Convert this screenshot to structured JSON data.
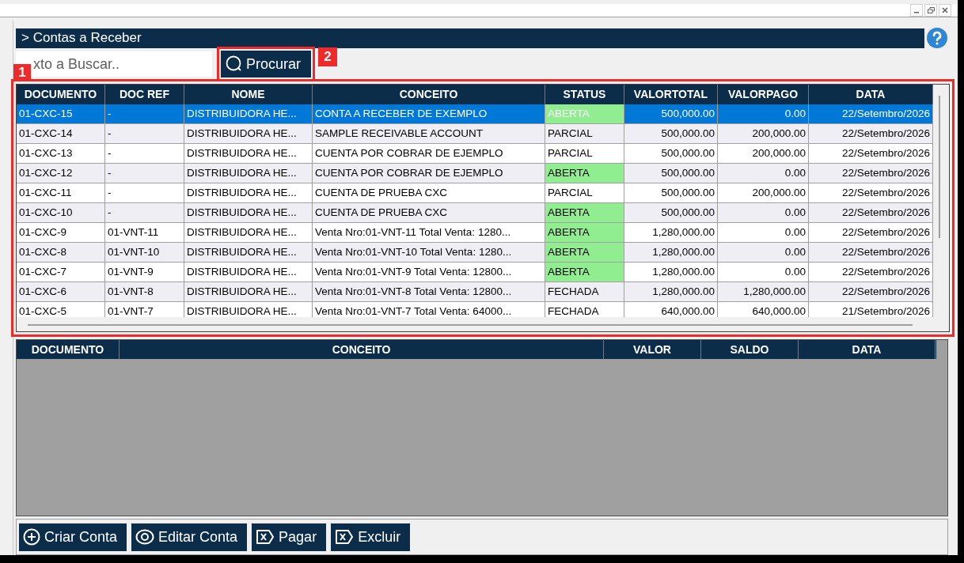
{
  "panel_title": "> Contas a Receber",
  "search": {
    "placeholder": "xto a Buscar..",
    "button": "Procurar"
  },
  "annotations": [
    "1",
    "2"
  ],
  "table": {
    "columns": [
      "DOCUMENTO",
      "DOC REF",
      "NOME",
      "CONCEITO",
      "STATUS",
      "VALORTOTAL",
      "VALORPAGO",
      "DATA"
    ],
    "rows": [
      {
        "selected": true,
        "color": "#90ee90",
        "cells": [
          "01-CXC-15",
          "-",
          "DISTRIBUIDORA HE...",
          "CONTA A RECEBER DE EXEMPLO",
          "ABERTA",
          "500,000.00",
          "0.00",
          "22/Setembro/2026"
        ]
      },
      {
        "selected": false,
        "cells": [
          "01-CXC-14",
          "-",
          "DISTRIBUIDORA HE...",
          "SAMPLE RECEIVABLE ACCOUNT",
          "PARCIAL",
          "500,000.00",
          "200,000.00",
          "22/Setembro/2026"
        ]
      },
      {
        "selected": false,
        "cells": [
          "01-CXC-13",
          "-",
          "DISTRIBUIDORA HE...",
          "CUENTA POR COBRAR DE EJEMPLO",
          "PARCIAL",
          "500,000.00",
          "200,000.00",
          "22/Setembro/2026"
        ]
      },
      {
        "selected": false,
        "color": "#90ee90",
        "cells": [
          "01-CXC-12",
          "-",
          "DISTRIBUIDORA HE...",
          "CUENTA POR COBRAR DE EJEMPLO",
          "ABERTA",
          "500,000.00",
          "0.00",
          "22/Setembro/2026"
        ]
      },
      {
        "selected": false,
        "cells": [
          "01-CXC-11",
          "-",
          "DISTRIBUIDORA HE...",
          "CUENTA DE PRUEBA CXC",
          "PARCIAL",
          "500,000.00",
          "200,000.00",
          "22/Setembro/2026"
        ]
      },
      {
        "selected": false,
        "color": "#90ee90",
        "cells": [
          "01-CXC-10",
          "-",
          "DISTRIBUIDORA HE...",
          "CUENTA DE PRUEBA CXC",
          "ABERTA",
          "500,000.00",
          "0.00",
          "22/Setembro/2026"
        ]
      },
      {
        "selected": false,
        "color": "#90ee90",
        "cells": [
          "01-CXC-9",
          "01-VNT-11",
          "DISTRIBUIDORA HE...",
          "Venta Nro:01-VNT-11 Total Venta: 1280...",
          "ABERTA",
          "1,280,000.00",
          "0.00",
          "22/Setembro/2026"
        ]
      },
      {
        "selected": false,
        "color": "#90ee90",
        "cells": [
          "01-CXC-8",
          "01-VNT-10",
          "DISTRIBUIDORA HE...",
          "Venta Nro:01-VNT-10 Total Venta: 1280...",
          "ABERTA",
          "1,280,000.00",
          "0.00",
          "22/Setembro/2026"
        ]
      },
      {
        "selected": false,
        "color": "#90ee90",
        "cells": [
          "01-CXC-7",
          "01-VNT-9",
          "DISTRIBUIDORA HE...",
          "Venta Nro:01-VNT-9 Total Venta: 12800...",
          "ABERTA",
          "1,280,000.00",
          "0.00",
          "22/Setembro/2026"
        ]
      },
      {
        "selected": false,
        "cells": [
          "01-CXC-6",
          "01-VNT-8",
          "DISTRIBUIDORA HE...",
          "Venta Nro:01-VNT-8 Total Venta: 12800...",
          "FECHADA",
          "1,280,000.00",
          "1,280,000.00",
          "22/Setembro/2026"
        ]
      },
      {
        "selected": false,
        "cells": [
          "01-CXC-5",
          "01-VNT-7",
          "DISTRIBUIDORA HE...",
          "Venta Nro:01-VNT-7 Total Venta: 64000...",
          "FECHADA",
          "640,000.00",
          "640,000.00",
          "21/Setembro/2026"
        ]
      }
    ]
  },
  "detail_table": {
    "columns": [
      "DOCUMENTO",
      "CONCEITO",
      "VALOR",
      "SALDO",
      "DATA"
    ]
  },
  "buttons": [
    {
      "kind": "add",
      "label": "Criar Conta"
    },
    {
      "kind": "edit",
      "label": "Editar Conta"
    },
    {
      "kind": "pay",
      "label": "Pagar"
    },
    {
      "kind": "delete",
      "label": "Excluir"
    }
  ]
}
